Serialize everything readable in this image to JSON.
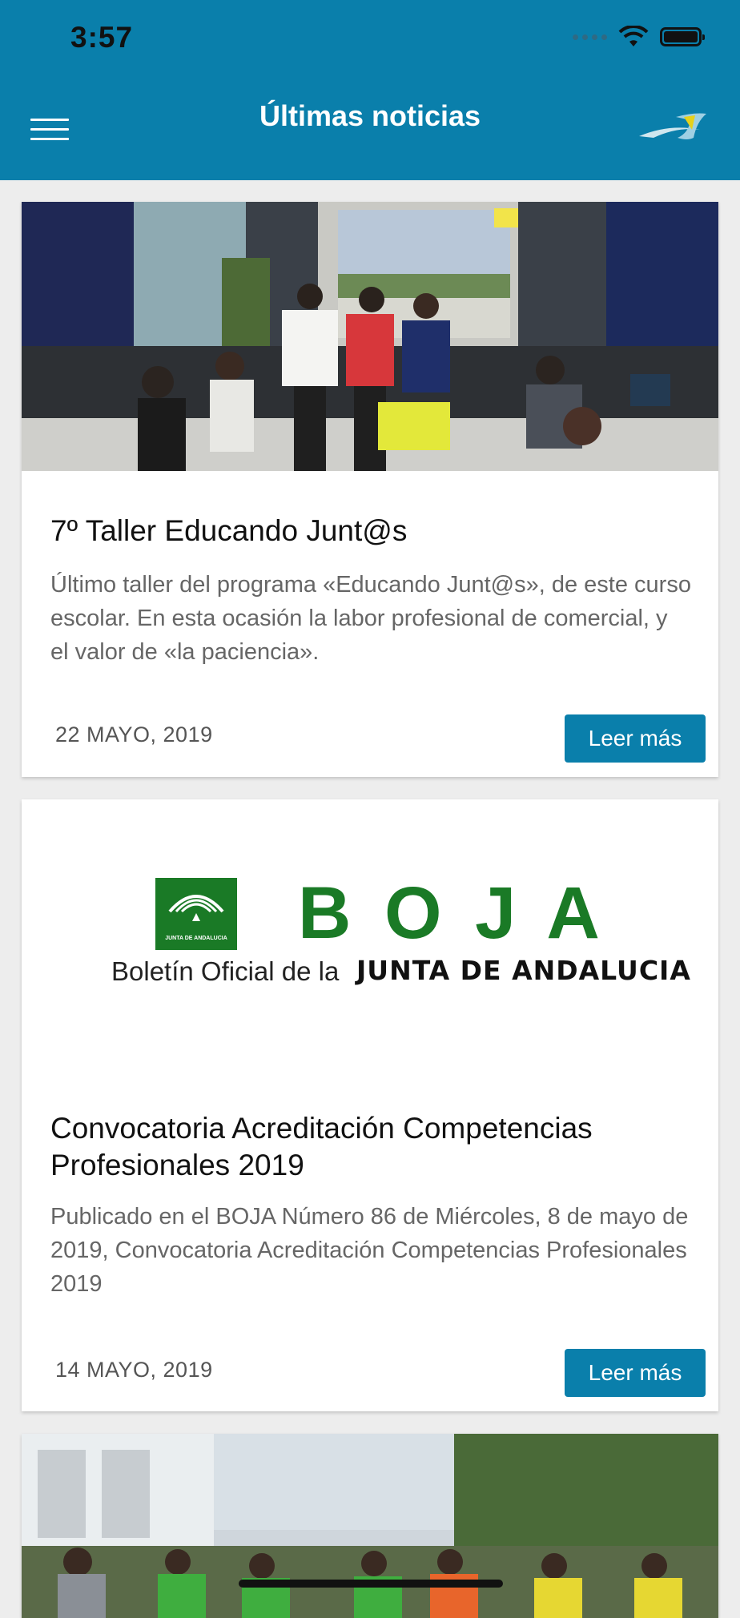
{
  "status": {
    "time": "3:57"
  },
  "header": {
    "title": "Últimas noticias"
  },
  "icons": {
    "menu": "hamburger-icon",
    "logo": "swoosh-logo-icon",
    "wifi": "wifi-icon",
    "battery": "battery-icon"
  },
  "colors": {
    "brand": "#0a7fab",
    "boja_green": "#1a7a26"
  },
  "news": [
    {
      "title": "7º Taller Educando Junt@s",
      "excerpt": "Último taller del programa «Educando Junt@s», de este curso escolar. En esta ocasión la labor profesional de comercial, y el valor de «la paciencia».",
      "date": "22 MAYO, 2019",
      "button": "Leer más"
    },
    {
      "title": "Convocatoria Acreditación Competencias Profesionales 2019",
      "excerpt": "Publicado en el BOJA Número 86 de Miércoles, 8 de mayo de 2019, Convocatoria Acreditación Competencias Profesionales 2019",
      "date": "14 MAYO, 2019",
      "button": "Leer más",
      "logo": {
        "letters": "B O J A",
        "line1": "Boletín Oficial de la",
        "line2": "JUNTA DE ANDALUCIA",
        "seal": "JUNTA DE ANDALUCIA"
      }
    }
  ]
}
